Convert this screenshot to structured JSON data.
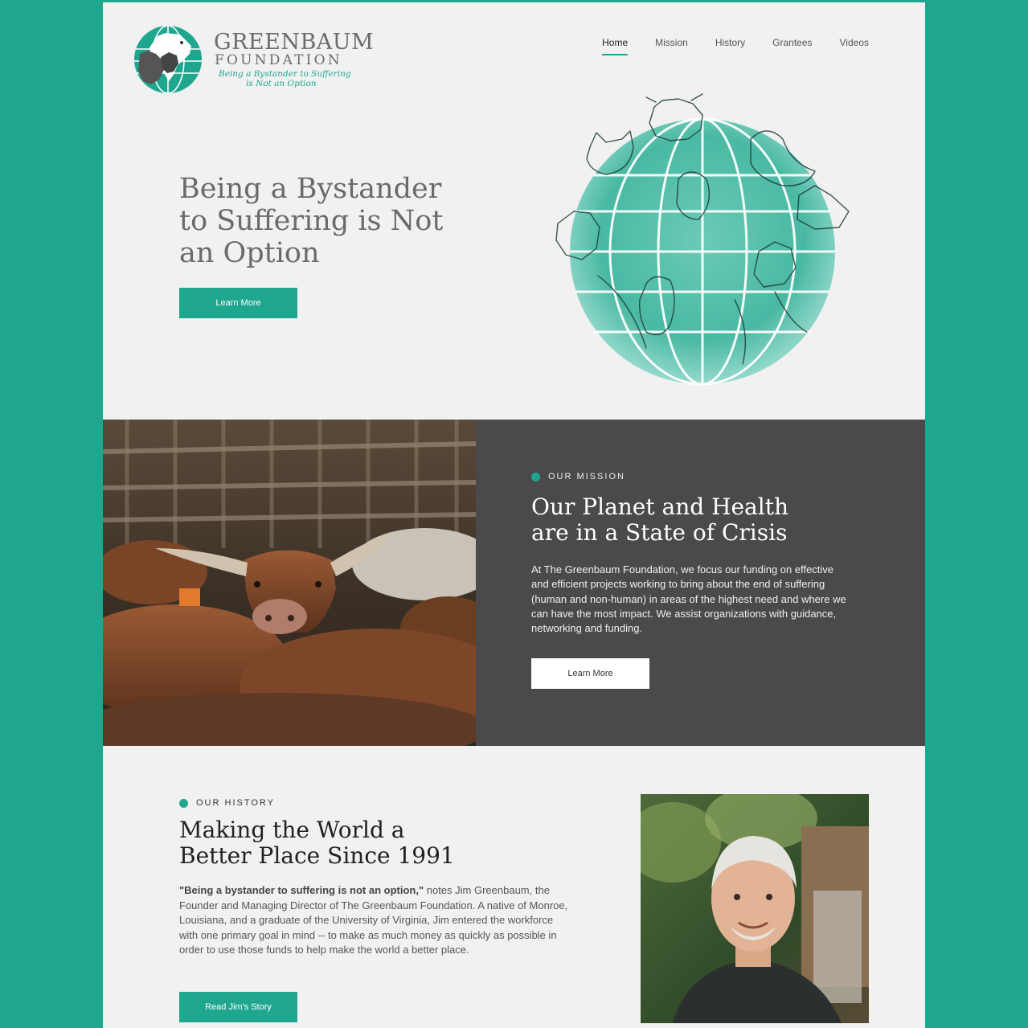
{
  "header": {
    "logo": {
      "name": "GREENBAUM",
      "subname": "FOUNDATION",
      "tagline_line1": "Being a Bystander to Suffering",
      "tagline_line2": "is Not an Option"
    },
    "nav": [
      {
        "label": "Home",
        "active": true
      },
      {
        "label": "Mission",
        "active": false
      },
      {
        "label": "History",
        "active": false
      },
      {
        "label": "Grantees",
        "active": false
      },
      {
        "label": "Videos",
        "active": false
      }
    ]
  },
  "hero": {
    "title": "Being a Bystander to Suffering is Not an Option",
    "button_label": "Learn More",
    "illustration": "globe-of-animals-illustration"
  },
  "mission": {
    "eyebrow": "OUR MISSION",
    "title_line1": "Our Planet and Health",
    "title_line2": "are in a State of Crisis",
    "body": "At The Greenbaum Foundation, we focus our funding on effective and efficient projects working to bring about the end of suffering (human and non-human) in areas of the highest need and where we can have the most impact. We assist organizations with guidance, networking and funding.",
    "button_label": "Learn More",
    "photo": "cattle-in-pen-photo"
  },
  "history": {
    "eyebrow": "OUR HISTORY",
    "title_line1": "Making the World a",
    "title_line2": "Better Place Since 1991",
    "body_quote": "\"Being a bystander to suffering is not an option,\"",
    "body_rest": " notes Jim Greenbaum, the Founder and Managing Director of The Greenbaum Foundation.  A native of Monroe, Louisiana, and a graduate of the University of Virginia, Jim entered the workforce with one primary goal in mind -- to make as much money as quickly as possible in order to use those funds to help make the world a better place.",
    "button_label": "Read Jim's Story",
    "photo": "jim-greenbaum-portrait"
  },
  "colors": {
    "accent": "#1fa68f",
    "background": "#f1f1f1",
    "mission_panel": "#4a4a4c"
  }
}
